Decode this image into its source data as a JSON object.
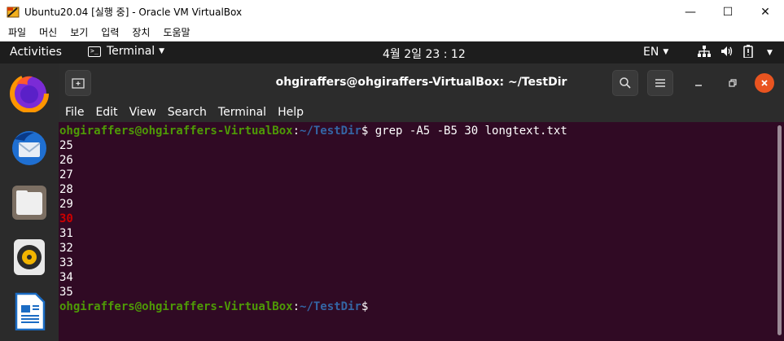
{
  "host_window": {
    "title": "Ubuntu20.04 [실행 중] - Oracle VM VirtualBox",
    "minimize_glyph": "—",
    "maximize_glyph": "☐",
    "close_glyph": "✕"
  },
  "vbox_menu": [
    "파일",
    "머신",
    "보기",
    "입력",
    "장치",
    "도움말"
  ],
  "topbar": {
    "activities": "Activities",
    "app_name": "Terminal",
    "clock": "4월 2일  23 : 12",
    "language": "EN"
  },
  "dock": {
    "items": [
      "firefox-icon",
      "thunderbird-icon",
      "files-icon",
      "rhythmbox-icon",
      "libreoffice-writer-icon"
    ]
  },
  "terminal": {
    "title": "ohgiraffers@ohgiraffers-VirtualBox: ~/TestDir",
    "menu": [
      "File",
      "Edit",
      "View",
      "Search",
      "Terminal",
      "Help"
    ],
    "prompt_user": "ohgiraffers@ohgiraffers-VirtualBox",
    "prompt_sep": ":",
    "prompt_path": "~/TestDir",
    "prompt_end": "$",
    "command": " grep -A5 -B5 30 longtext.txt",
    "output_before": [
      "25",
      "26",
      "27",
      "28",
      "29"
    ],
    "match": "30",
    "output_after": [
      "31",
      "32",
      "33",
      "34",
      "35"
    ]
  }
}
